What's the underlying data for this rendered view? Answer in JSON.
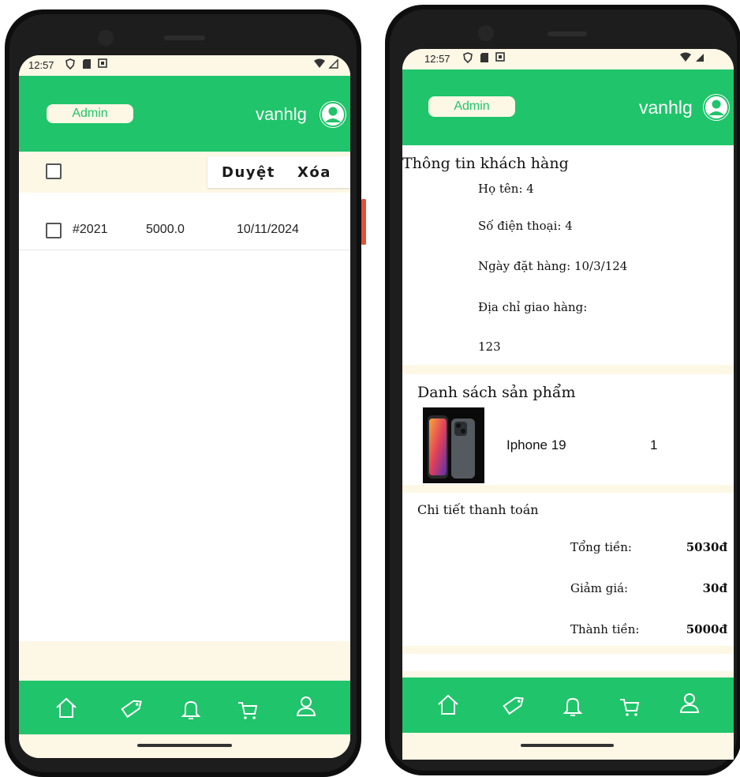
{
  "status_bar": {
    "time": "12:57"
  },
  "left_screen": {
    "header": {
      "admin_label": "Admin",
      "username": "vanhlg"
    },
    "actions": {
      "approve_label": "Duyệt",
      "delete_label": "Xóa"
    },
    "orders": [
      {
        "id": "#2021",
        "total": "5000.0",
        "date": "10/11/2024"
      }
    ]
  },
  "right_screen": {
    "header": {
      "admin_label": "Admin",
      "username": "vanhlg"
    },
    "customer": {
      "section_title": "Thông tin khách hàng",
      "name_label": "Họ tên:",
      "name_value": "4",
      "phone_label": "Số điện thoại:",
      "phone_value": "4",
      "date_label": "Ngày đặt hàng:",
      "date_value": "10/3/124",
      "address_label": "Địa chỉ giao hàng:",
      "address_value": "123"
    },
    "products": {
      "section_title": "Danh sách sản phẩm",
      "items": [
        {
          "name": "Iphone 19",
          "quantity": "1"
        }
      ]
    },
    "payment": {
      "section_title": "Chi tiết thanh toán",
      "rows": [
        {
          "label": "Tổng tiền:",
          "value": "5030đ"
        },
        {
          "label": "Giảm giá:",
          "value": "30đ"
        },
        {
          "label": "Thành tiền:",
          "value": "5000đ"
        }
      ]
    }
  },
  "nav": [
    "home-icon",
    "tag-icon",
    "bell-icon",
    "cart-icon",
    "user-icon"
  ],
  "colors": {
    "green": "#20c46a",
    "cream": "#fdf7e6"
  }
}
